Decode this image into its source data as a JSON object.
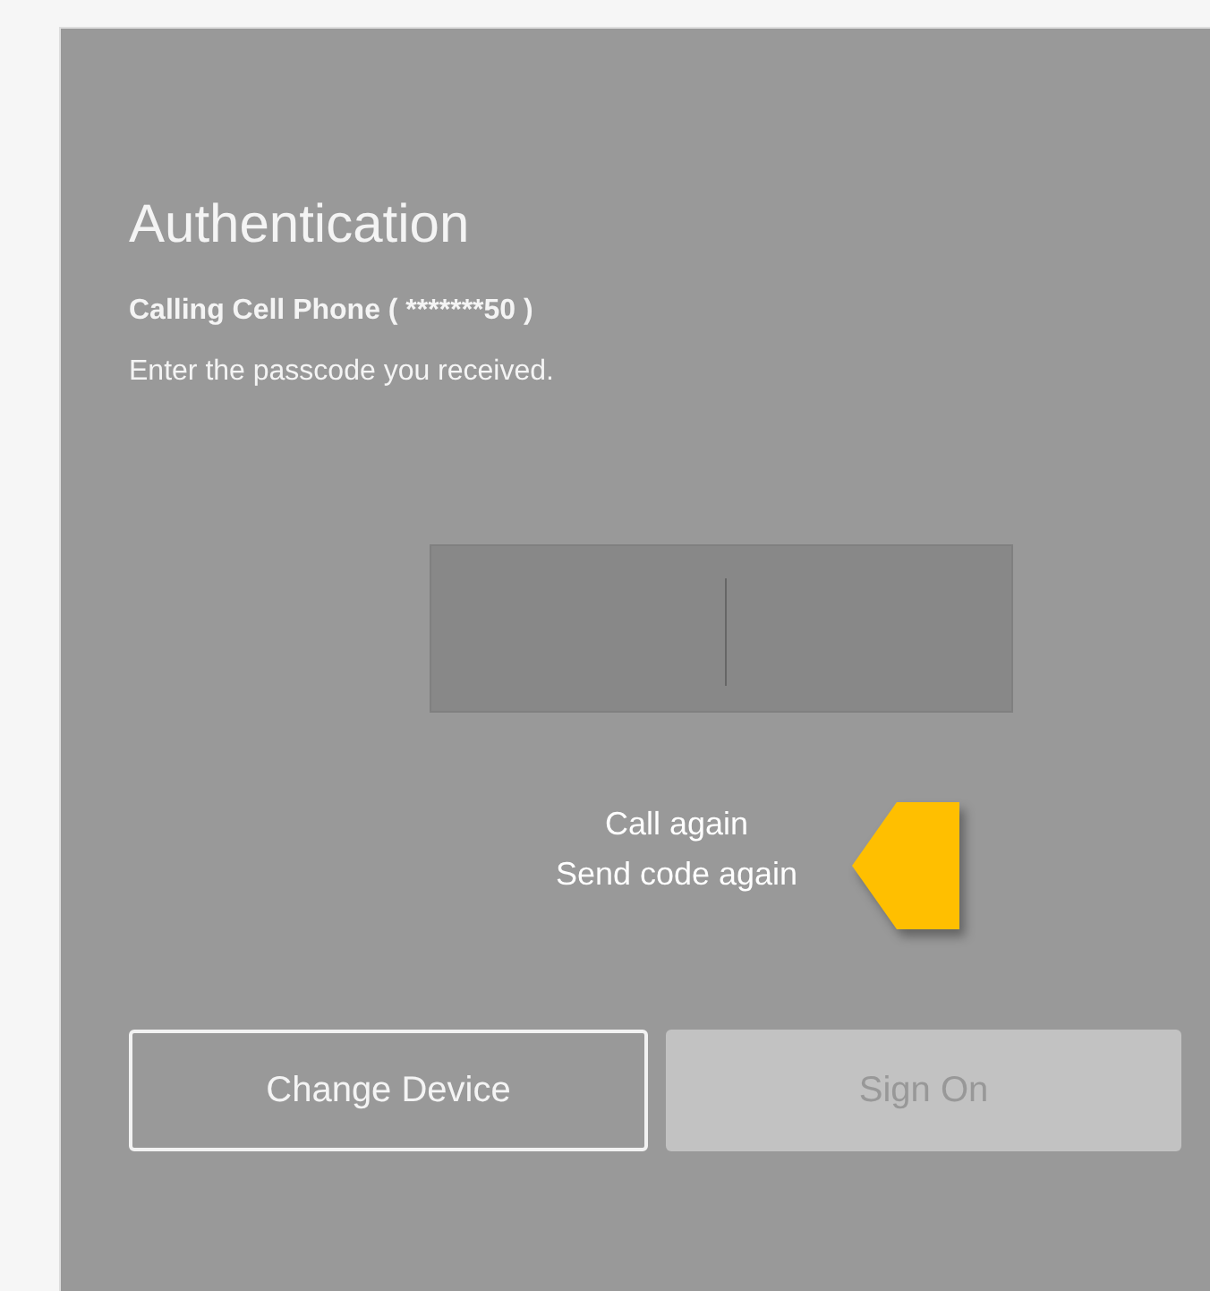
{
  "title": "Authentication",
  "calling": "Calling Cell Phone ( *******50 )",
  "instruction": "Enter the passcode you received.",
  "links": [
    "Call again",
    "Send code again"
  ],
  "buttons": [
    {
      "label": "Change Device",
      "disabled": false
    },
    {
      "label": "Sign On",
      "disabled": true
    }
  ]
}
